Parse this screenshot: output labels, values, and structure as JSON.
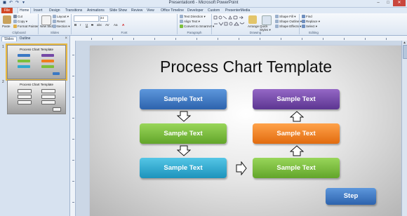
{
  "window": {
    "title": "Presentation6 - Microsoft PowerPoint",
    "minimize": "–",
    "maximize": "□",
    "close": "✕"
  },
  "quick_access": [
    "◼",
    "↶",
    "↷",
    "▾"
  ],
  "tabs": [
    "File",
    "Home",
    "Insert",
    "Design",
    "Transitions",
    "Animations",
    "Slide Show",
    "Review",
    "View",
    "Office Timeline",
    "Developer",
    "Custom",
    "PresenterMedia"
  ],
  "ribbon": {
    "clipboard": {
      "label": "Clipboard",
      "paste": "Paste",
      "cut": "Cut",
      "copy": "Copy ▾",
      "format_painter": "Format Painter"
    },
    "slides": {
      "label": "Slides",
      "new_slide": "New Slide ▾",
      "layout": "Layout ▾",
      "reset": "Reset",
      "section": "Section ▾"
    },
    "font": {
      "label": "Font",
      "font_name": "",
      "font_size": "44",
      "bold": "B",
      "italic": "I",
      "underline": "U",
      "strike": "S",
      "shadow": "abc",
      "spacing": "AV",
      "case": "Aa",
      "color": "A"
    },
    "paragraph": {
      "label": "Paragraph",
      "text_direction": "Text Direction ▾",
      "align_text": "Align Text ▾",
      "smartart": "Convert to SmartArt ▾"
    },
    "drawing": {
      "label": "Drawing",
      "arrange": "Arrange",
      "quick_styles": "Quick Styles ▾",
      "shape_fill": "Shape Fill ▾",
      "shape_outline": "Shape Outline ▾",
      "shape_effects": "Shape Effects ▾"
    },
    "editing": {
      "label": "Editing",
      "find": "Find",
      "replace": "Replace ▾",
      "select": "Select ▾"
    }
  },
  "sidepanel": {
    "tabs": [
      "Slides",
      "Outline"
    ],
    "close": "×"
  },
  "thumbnails": [
    {
      "number": "1",
      "title": "Process Chart Template"
    },
    {
      "number": "2",
      "title": "Process Chart Template"
    }
  ],
  "slide": {
    "title": "Process Chart Template",
    "box_labels": [
      "Sample Text",
      "Sample Text",
      "Sample Text",
      "Sample Text",
      "Sample Text",
      "Sample Text"
    ],
    "step_label": "Step"
  },
  "colors": {
    "blue": "#3a78c4",
    "green": "#7cbf3a",
    "cyan": "#30a9cf",
    "purple": "#7448a6",
    "orange": "#ef7d1e",
    "file_tab": "#d24726"
  }
}
